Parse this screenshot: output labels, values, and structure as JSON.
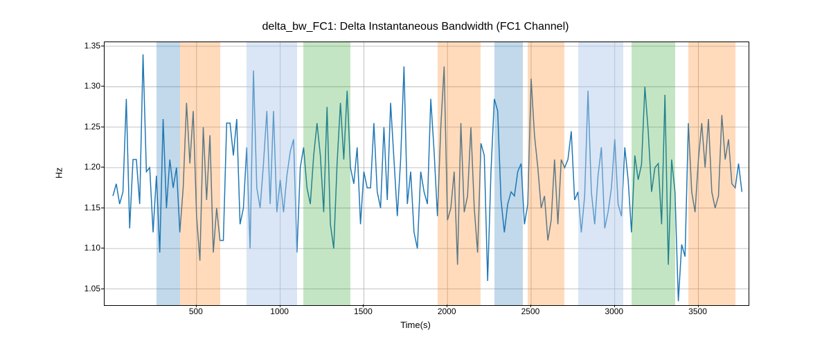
{
  "chart_data": {
    "type": "line",
    "title": "delta_bw_FC1: Delta Instantaneous Bandwidth (FC1 Channel)",
    "xlabel": "Time(s)",
    "ylabel": "Hz",
    "xlim": [
      -50,
      3800
    ],
    "ylim": [
      1.03,
      1.355
    ],
    "xticks": [
      500,
      1000,
      1500,
      2000,
      2500,
      3000,
      3500
    ],
    "yticks": [
      1.05,
      1.1,
      1.15,
      1.2,
      1.25,
      1.3,
      1.35
    ],
    "bands": [
      {
        "start": 260,
        "end": 400,
        "color": "blue"
      },
      {
        "start": 400,
        "end": 640,
        "color": "orange"
      },
      {
        "start": 800,
        "end": 940,
        "color": "ltblue"
      },
      {
        "start": 940,
        "end": 1100,
        "color": "ltblue"
      },
      {
        "start": 1140,
        "end": 1420,
        "color": "green"
      },
      {
        "start": 1940,
        "end": 2200,
        "color": "orange"
      },
      {
        "start": 2280,
        "end": 2450,
        "color": "blue"
      },
      {
        "start": 2480,
        "end": 2700,
        "color": "orange"
      },
      {
        "start": 2780,
        "end": 2910,
        "color": "ltblue"
      },
      {
        "start": 2910,
        "end": 3050,
        "color": "ltblue"
      },
      {
        "start": 3100,
        "end": 3360,
        "color": "green"
      },
      {
        "start": 3440,
        "end": 3720,
        "color": "orange"
      }
    ],
    "series": [
      {
        "name": "delta_bw_FC1",
        "color": "#1f77b4",
        "x": [
          0,
          20,
          40,
          60,
          80,
          100,
          120,
          140,
          160,
          180,
          200,
          220,
          240,
          260,
          280,
          300,
          320,
          340,
          360,
          380,
          400,
          420,
          440,
          460,
          480,
          500,
          520,
          540,
          560,
          580,
          600,
          620,
          640,
          660,
          680,
          700,
          720,
          740,
          760,
          780,
          800,
          820,
          840,
          860,
          880,
          900,
          920,
          940,
          960,
          980,
          1000,
          1020,
          1040,
          1060,
          1080,
          1100,
          1120,
          1140,
          1160,
          1180,
          1200,
          1220,
          1240,
          1260,
          1280,
          1300,
          1320,
          1340,
          1360,
          1380,
          1400,
          1420,
          1440,
          1460,
          1480,
          1500,
          1520,
          1540,
          1560,
          1580,
          1600,
          1620,
          1640,
          1660,
          1680,
          1700,
          1720,
          1740,
          1760,
          1780,
          1800,
          1820,
          1840,
          1860,
          1880,
          1900,
          1920,
          1940,
          1960,
          1980,
          2000,
          2020,
          2040,
          2060,
          2080,
          2100,
          2120,
          2140,
          2160,
          2180,
          2200,
          2220,
          2240,
          2260,
          2280,
          2300,
          2320,
          2340,
          2360,
          2380,
          2400,
          2420,
          2440,
          2460,
          2480,
          2500,
          2520,
          2540,
          2560,
          2580,
          2600,
          2620,
          2640,
          2660,
          2680,
          2700,
          2720,
          2740,
          2760,
          2780,
          2800,
          2820,
          2840,
          2860,
          2880,
          2900,
          2920,
          2940,
          2960,
          2980,
          3000,
          3020,
          3040,
          3060,
          3080,
          3100,
          3120,
          3140,
          3160,
          3180,
          3200,
          3220,
          3240,
          3260,
          3280,
          3300,
          3320,
          3340,
          3360,
          3380,
          3400,
          3420,
          3440,
          3460,
          3480,
          3500,
          3520,
          3540,
          3560,
          3580,
          3600,
          3620,
          3640,
          3660,
          3680,
          3700,
          3720,
          3740,
          3760
        ],
        "y": [
          1.165,
          1.18,
          1.155,
          1.17,
          1.285,
          1.125,
          1.21,
          1.21,
          1.155,
          1.34,
          1.195,
          1.2,
          1.12,
          1.19,
          1.095,
          1.26,
          1.15,
          1.21,
          1.175,
          1.2,
          1.12,
          1.175,
          1.28,
          1.205,
          1.27,
          1.14,
          1.085,
          1.25,
          1.16,
          1.24,
          1.095,
          1.15,
          1.11,
          1.11,
          1.255,
          1.255,
          1.215,
          1.26,
          1.13,
          1.15,
          1.225,
          1.1,
          1.32,
          1.175,
          1.15,
          1.205,
          1.27,
          1.155,
          1.27,
          1.145,
          1.185,
          1.145,
          1.19,
          1.22,
          1.235,
          1.095,
          1.2,
          1.225,
          1.175,
          1.155,
          1.215,
          1.255,
          1.215,
          1.145,
          1.275,
          1.13,
          1.1,
          1.205,
          1.28,
          1.21,
          1.295,
          1.2,
          1.18,
          1.225,
          1.13,
          1.195,
          1.175,
          1.175,
          1.255,
          1.17,
          1.15,
          1.25,
          1.16,
          1.28,
          1.21,
          1.14,
          1.21,
          1.325,
          1.155,
          1.195,
          1.12,
          1.1,
          1.195,
          1.17,
          1.155,
          1.285,
          1.22,
          1.14,
          1.25,
          1.325,
          1.135,
          1.15,
          1.195,
          1.08,
          1.255,
          1.145,
          1.165,
          1.25,
          1.15,
          1.095,
          1.23,
          1.215,
          1.06,
          1.195,
          1.285,
          1.27,
          1.16,
          1.12,
          1.155,
          1.17,
          1.165,
          1.195,
          1.205,
          1.13,
          1.155,
          1.31,
          1.24,
          1.2,
          1.15,
          1.165,
          1.11,
          1.135,
          1.21,
          1.13,
          1.21,
          1.2,
          1.21,
          1.245,
          1.16,
          1.17,
          1.12,
          1.165,
          1.295,
          1.17,
          1.13,
          1.19,
          1.225,
          1.125,
          1.145,
          1.175,
          1.235,
          1.155,
          1.14,
          1.225,
          1.185,
          1.12,
          1.215,
          1.185,
          1.204,
          1.3,
          1.245,
          1.17,
          1.2,
          1.205,
          1.13,
          1.29,
          1.08,
          1.21,
          1.17,
          1.035,
          1.105,
          1.09,
          1.255,
          1.17,
          1.145,
          1.21,
          1.255,
          1.2,
          1.26,
          1.17,
          1.15,
          1.165,
          1.265,
          1.21,
          1.235,
          1.18,
          1.175,
          1.205,
          1.17
        ]
      }
    ]
  }
}
